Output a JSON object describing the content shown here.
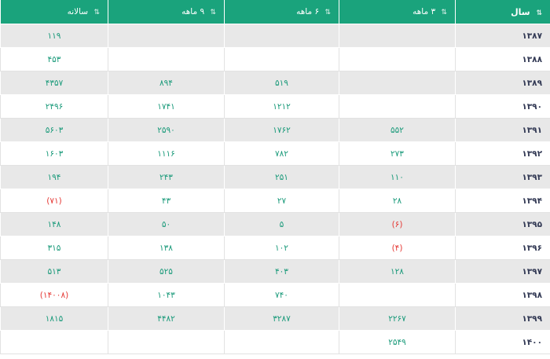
{
  "colors": {
    "header_bg": "#1aa37c",
    "header_text": "#ffffff",
    "row_alt": "#e8e8e8",
    "value_text": "#1a9a7a",
    "negative_text": "#e53935",
    "year_text": "#333a55"
  },
  "header": {
    "columns": [
      {
        "label": "سال",
        "icon": "sort-icon"
      },
      {
        "label": "۳ ماهه",
        "icon": "sort-icon"
      },
      {
        "label": "۶ ماهه",
        "icon": "sort-icon"
      },
      {
        "label": "۹ ماهه",
        "icon": "sort-icon"
      },
      {
        "label": "سالانه",
        "icon": "sort-icon"
      }
    ]
  },
  "rows": [
    {
      "year": "۱۳۸۷",
      "m3": "",
      "m6": "",
      "m9": "",
      "annual": "۱۱۹"
    },
    {
      "year": "۱۳۸۸",
      "m3": "",
      "m6": "",
      "m9": "",
      "annual": "۴۵۳"
    },
    {
      "year": "۱۳۸۹",
      "m3": "",
      "m6": "۵۱۹",
      "m9": "۸۹۴",
      "annual": "۴۳۵۷"
    },
    {
      "year": "۱۳۹۰",
      "m3": "",
      "m6": "۱۲۱۲",
      "m9": "۱۷۴۱",
      "annual": "۲۴۹۶"
    },
    {
      "year": "۱۳۹۱",
      "m3": "۵۵۲",
      "m6": "۱۷۶۲",
      "m9": "۲۵۹۰",
      "annual": "۵۶۰۳"
    },
    {
      "year": "۱۳۹۲",
      "m3": "۲۷۳",
      "m6": "۷۸۲",
      "m9": "۱۱۱۶",
      "annual": "۱۶۰۳"
    },
    {
      "year": "۱۳۹۳",
      "m3": "۱۱۰",
      "m6": "۲۵۱",
      "m9": "۲۴۳",
      "annual": "۱۹۴"
    },
    {
      "year": "۱۳۹۴",
      "m3": "۲۸",
      "m6": "۲۷",
      "m9": "۴۳",
      "annual": "(۷۱)"
    },
    {
      "year": "۱۳۹۵",
      "m3": "(۶)",
      "m6": "۵",
      "m9": "۵۰",
      "annual": "۱۴۸"
    },
    {
      "year": "۱۳۹۶",
      "m3": "(۴)",
      "m6": "۱۰۲",
      "m9": "۱۳۸",
      "annual": "۳۱۵"
    },
    {
      "year": "۱۳۹۷",
      "m3": "۱۲۸",
      "m6": "۴۰۳",
      "m9": "۵۲۵",
      "annual": "۵۱۳"
    },
    {
      "year": "۱۳۹۸",
      "m3": "",
      "m6": "۷۴۰",
      "m9": "۱۰۴۳",
      "annual": "(۱۴۰۰۸)"
    },
    {
      "year": "۱۳۹۹",
      "m3": "۲۲۶۷",
      "m6": "۳۲۸۷",
      "m9": "۴۴۸۲",
      "annual": "۱۸۱۵"
    },
    {
      "year": "۱۴۰۰",
      "m3": "۲۵۴۹",
      "m6": "",
      "m9": "",
      "annual": ""
    }
  ]
}
